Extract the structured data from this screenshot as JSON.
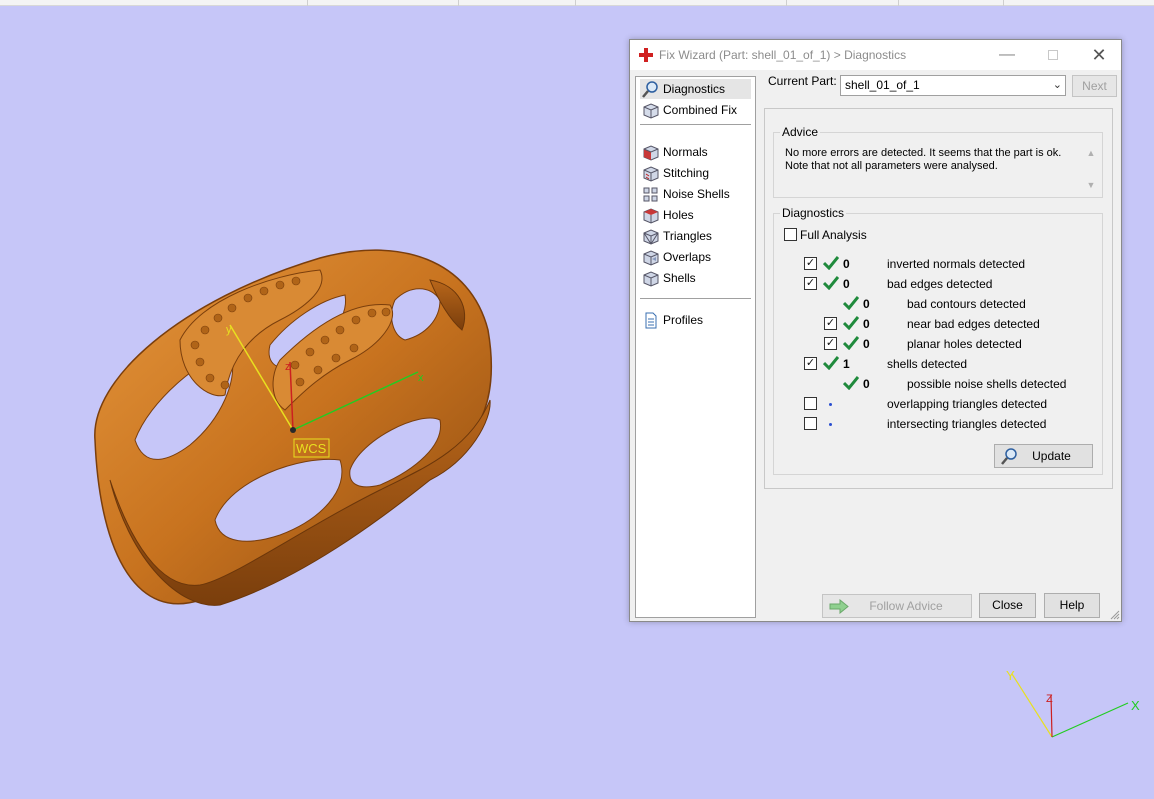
{
  "dialog": {
    "title": "Fix Wizard (Part: shell_01_of_1) > Diagnostics",
    "minimize_glyph": "—",
    "close_glyph": "✕"
  },
  "sidebar": {
    "items": [
      {
        "label": "Diagnostics",
        "icon": "magnifier-icon"
      },
      {
        "label": "Combined Fix",
        "icon": "cube-icon"
      },
      {
        "label": "Normals",
        "icon": "normals-cube-icon"
      },
      {
        "label": "Stitching",
        "icon": "stitching-cube-icon"
      },
      {
        "label": "Noise Shells",
        "icon": "noise-shells-icon"
      },
      {
        "label": "Holes",
        "icon": "holes-cube-icon"
      },
      {
        "label": "Triangles",
        "icon": "triangles-cube-icon"
      },
      {
        "label": "Overlaps",
        "icon": "overlaps-cube-icon"
      },
      {
        "label": "Shells",
        "icon": "shells-cube-icon"
      },
      {
        "label": "Profiles",
        "icon": "document-icon"
      }
    ]
  },
  "header": {
    "current_part_label": "Current Part:",
    "current_part_value": "shell_01_of_1",
    "next_label": "Next"
  },
  "advice": {
    "label": "Advice",
    "line1": "No more errors are detected. It seems that the part is ok.",
    "line2": "Note that not all parameters were analysed."
  },
  "diagnostics": {
    "label": "Diagnostics",
    "full_analysis_label": "Full Analysis",
    "full_analysis_checked": false,
    "rows": [
      {
        "label": "inverted normals detected",
        "count": "0",
        "checked": true,
        "status": "ok"
      },
      {
        "label": "bad edges detected",
        "count": "0",
        "checked": true,
        "status": "ok"
      },
      {
        "label": "bad contours detected",
        "count": "0",
        "checked": null,
        "status": "ok"
      },
      {
        "label": "near bad edges detected",
        "count": "0",
        "checked": true,
        "status": "ok"
      },
      {
        "label": "planar holes detected",
        "count": "0",
        "checked": true,
        "status": "ok"
      },
      {
        "label": "shells detected",
        "count": "1",
        "checked": true,
        "status": "ok"
      },
      {
        "label": "possible noise shells detected",
        "count": "0",
        "checked": null,
        "status": "ok"
      },
      {
        "label": "overlapping triangles detected",
        "count": "",
        "checked": false,
        "status": "pending"
      },
      {
        "label": "intersecting triangles detected",
        "count": "",
        "checked": false,
        "status": "pending"
      }
    ],
    "update_label": "Update"
  },
  "footer": {
    "follow_advice_label": "Follow Advice",
    "close_label": "Close",
    "help_label": "Help"
  },
  "viewport": {
    "wcs_label": "WCS",
    "axis_x": "x",
    "axis_y": "y",
    "axis_z": "z",
    "triad_x": "X",
    "triad_y": "Y",
    "triad_z": "Z"
  },
  "colors": {
    "background": "#c6c6f8",
    "ring": "#c8731f",
    "check_green": "#1f8a3c",
    "axis_x": "#22cc22",
    "axis_y": "#e8e020",
    "axis_z": "#cc2020"
  }
}
